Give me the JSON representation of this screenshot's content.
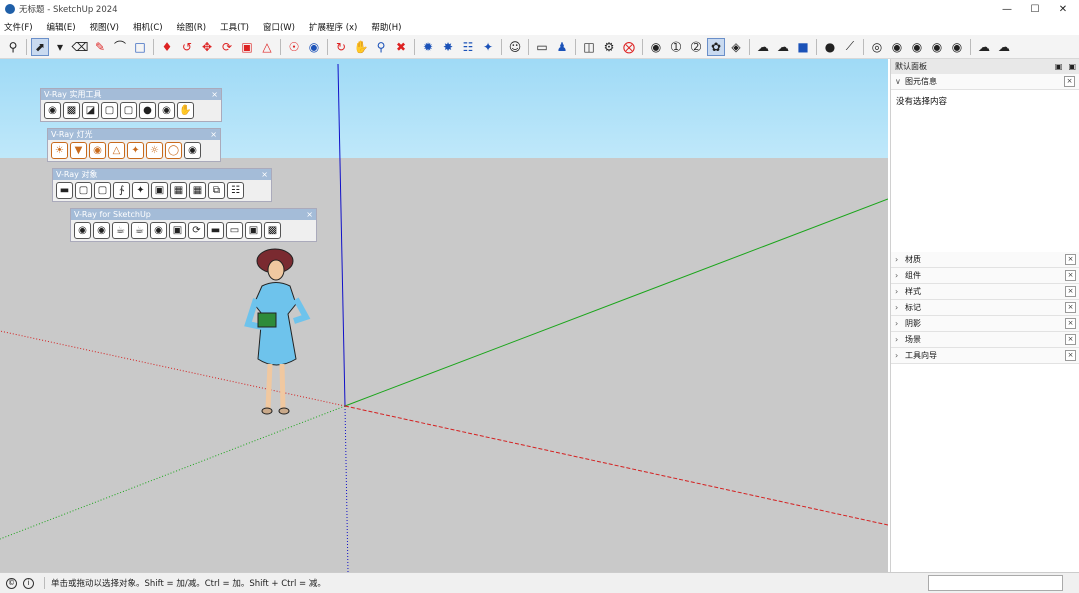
{
  "window": {
    "title": "无标题 - SketchUp 2024",
    "minimize": "—",
    "maximize": "☐",
    "close": "✕"
  },
  "menu": [
    "文件(F)",
    "编辑(E)",
    "视图(V)",
    "相机(C)",
    "绘图(R)",
    "工具(T)",
    "窗口(W)",
    "扩展程序 (x)",
    "帮助(H)"
  ],
  "vray_panels": {
    "utilities": "V-Ray 实用工具",
    "lights": "V-Ray 灯光",
    "objects": "V-Ray 对象",
    "sketchup": "V-Ray for SketchUp"
  },
  "tray": {
    "title": "默认面板",
    "entity_info": "图元信息",
    "no_selection": "没有选择内容",
    "sections": [
      "材质",
      "组件",
      "样式",
      "标记",
      "阴影",
      "场景",
      "工具向导"
    ]
  },
  "status": {
    "hint": "单击或拖动以选择对象。Shift = 加/减。Ctrl = 加。Shift + Ctrl = 减。"
  },
  "colors": {
    "sky_top": "#9fdaf6",
    "ground": "#c9c9c9",
    "axis_red": "#d42020",
    "axis_green": "#1aa51a",
    "axis_blue": "#1010c8",
    "vray_header": "#a4bcd8"
  }
}
